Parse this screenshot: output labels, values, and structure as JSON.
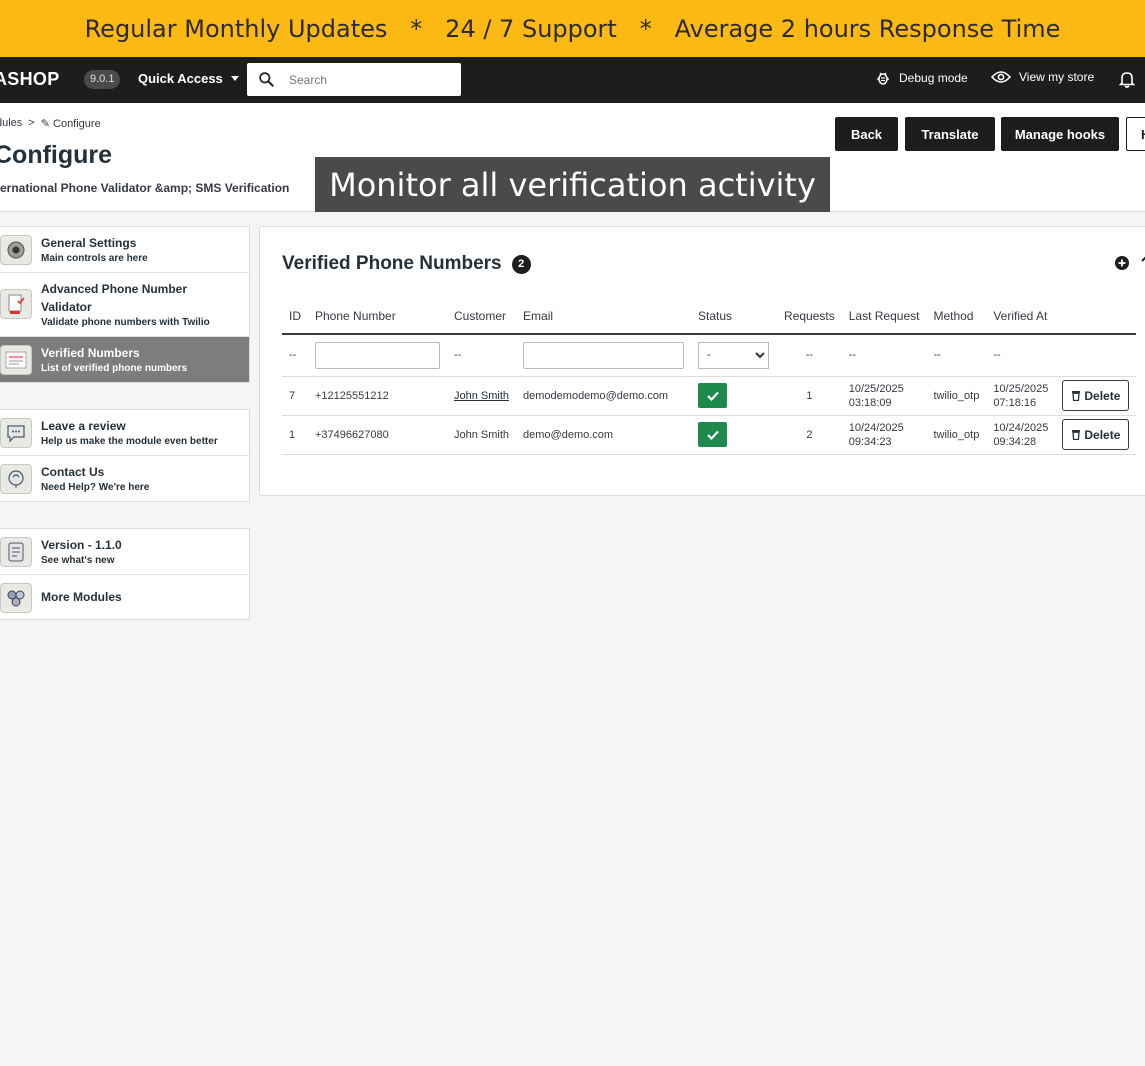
{
  "promo": {
    "text": "Regular Monthly Updates   *   24 / 7 Support   *   Average 2 hours Response Time"
  },
  "topbar": {
    "logo": "ASHOP",
    "version": "9.0.1",
    "quick_access": "Quick Access",
    "search_placeholder": "Search",
    "debug_mode": "Debug mode",
    "view_store": "View my store"
  },
  "header": {
    "breadcrumb_modules": "dules",
    "breadcrumb_sep": ">",
    "breadcrumb_configure": "✎ Configure",
    "title": "Configure",
    "subtitle": "ternational Phone Validator &amp; SMS Verification",
    "caption": "Monitor all verification activity",
    "buttons": {
      "back": "Back",
      "translate": "Translate",
      "manage_hooks": "Manage hooks",
      "help": "H"
    }
  },
  "sidebar": {
    "items": [
      {
        "title": "General Settings",
        "desc": "Main controls are here"
      },
      {
        "title": "Advanced Phone Number Validator",
        "desc": "Validate phone numbers with Twilio"
      },
      {
        "title": "Verified Numbers",
        "desc": "List of verified phone numbers"
      },
      {
        "title": "Leave a review",
        "desc": "Help us make the module even better"
      },
      {
        "title": "Contact Us",
        "desc": "Need Help? We're here"
      },
      {
        "title": "Version - 1.1.0",
        "desc": "See what's new"
      },
      {
        "title": "More Modules",
        "desc": ""
      }
    ]
  },
  "panel": {
    "title": "Verified Phone Numbers",
    "count": "2",
    "columns": [
      "ID",
      "Phone Number",
      "Customer",
      "Email",
      "Status",
      "Requests",
      "Last Request",
      "Method",
      "Verified At"
    ],
    "filter": {
      "placeholder": "--",
      "status_option": "-"
    },
    "rows": [
      {
        "id": "7",
        "phone": "+12125551212",
        "customer": "John Smith",
        "email": "demodemodemo@demo.com",
        "requests": "1",
        "last_date": "10/25/2025",
        "last_time": "03:18:09",
        "method": "twilio_otp",
        "verified_date": "10/25/2025",
        "verified_time": "07:18:16",
        "delete": "Delete"
      },
      {
        "id": "1",
        "phone": "+37496627080",
        "customer": "John Smith",
        "email": "demo@demo.com",
        "requests": "2",
        "last_date": "10/24/2025",
        "last_time": "09:34:23",
        "method": "twilio_otp",
        "verified_date": "10/24/2025",
        "verified_time": "09:34:28",
        "delete": "Delete"
      }
    ]
  }
}
